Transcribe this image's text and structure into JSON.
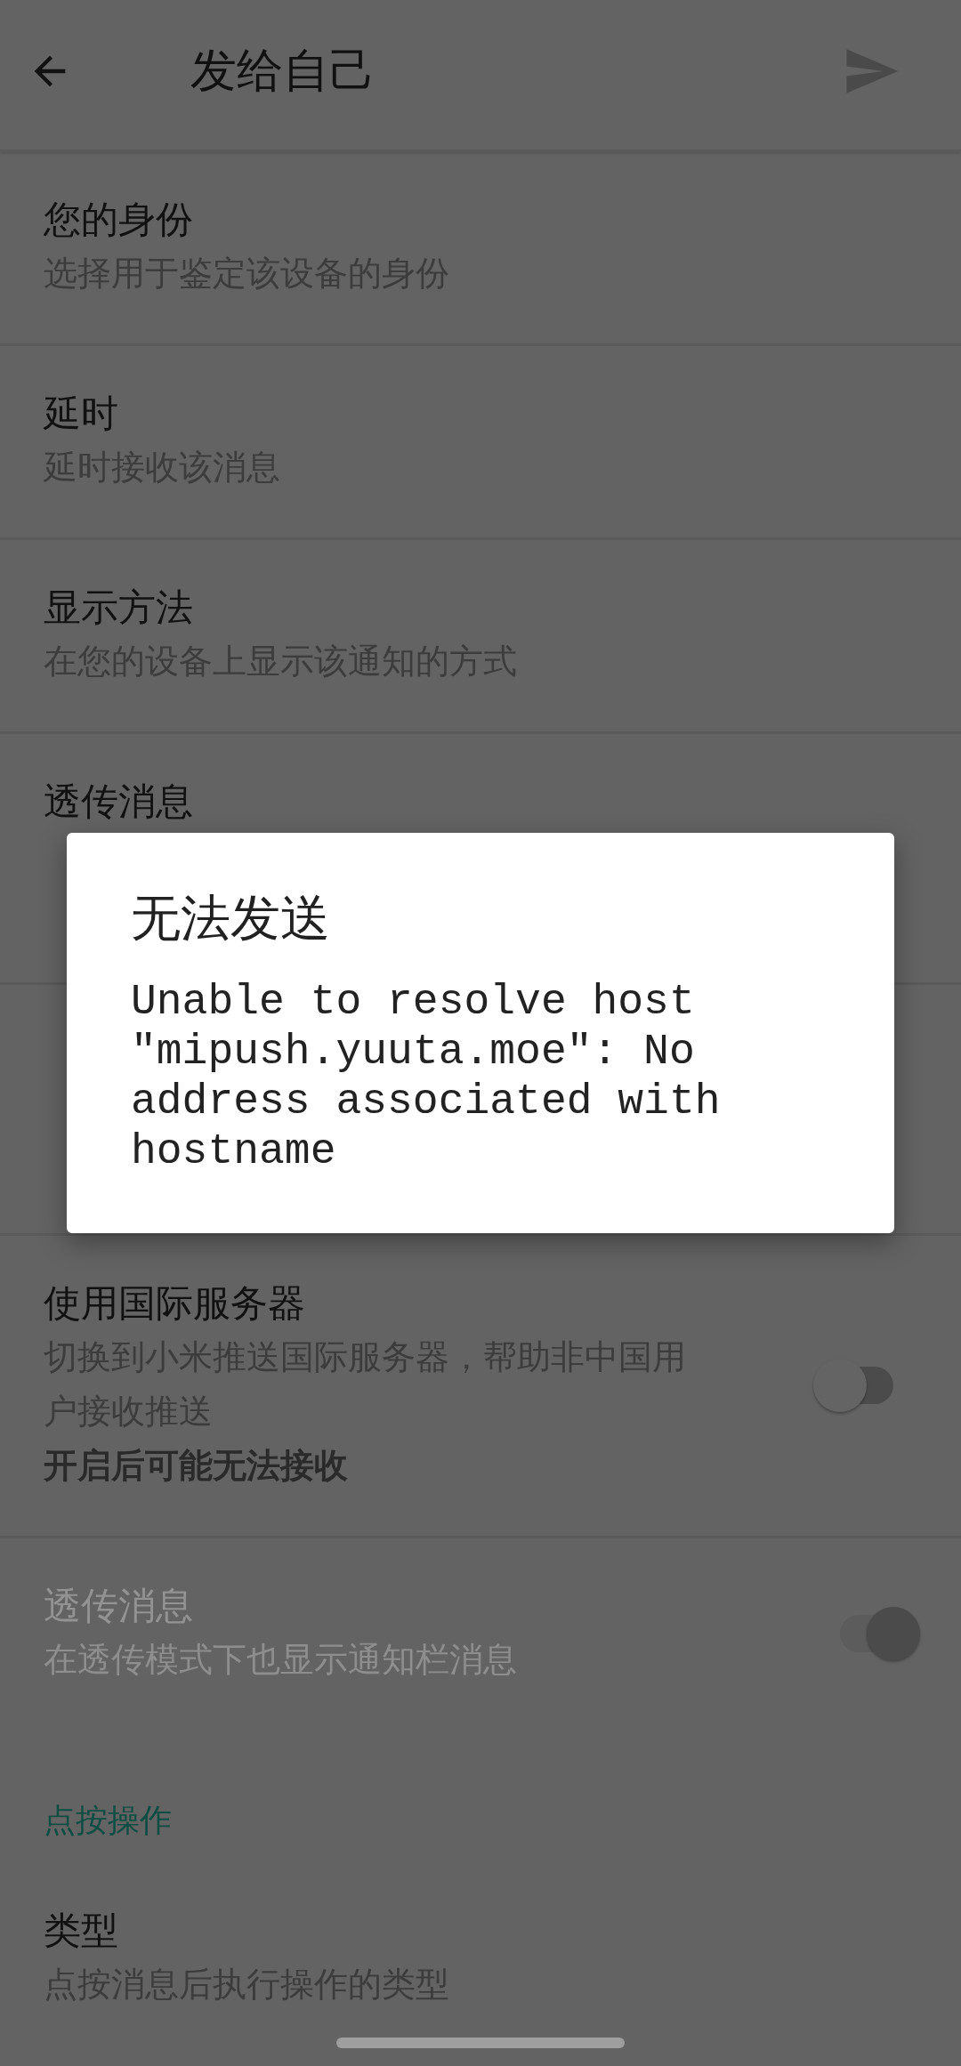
{
  "app_bar": {
    "title": "发给自己"
  },
  "rows": [
    {
      "kind": "text",
      "title": "您的身份",
      "subtitle": "选择用于鉴定该设备的身份"
    },
    {
      "kind": "text",
      "title": "延时",
      "subtitle": "延时接收该消息"
    },
    {
      "kind": "text",
      "title": "显示方法",
      "subtitle": "在您的设备上显示该通知的方式"
    },
    {
      "kind": "covered",
      "title": "透传消息"
    },
    {
      "kind": "covered"
    },
    {
      "kind": "switch",
      "title": "使用国际服务器",
      "subtitle": "切换到小米推送国际服务器，帮助非中国用户接收推送",
      "note": "开启后可能无法接收",
      "on": false,
      "disabled": false
    },
    {
      "kind": "switch",
      "title": "透传消息",
      "subtitle": "在透传模式下也显示通知栏消息",
      "on": true,
      "disabled": true
    }
  ],
  "section": {
    "header": "点按操作",
    "rows": [
      {
        "kind": "text",
        "title": "类型",
        "subtitle": "点按消息后执行操作的类型"
      }
    ]
  },
  "dialog": {
    "title": "无法发送",
    "message": "Unable to resolve host \"mipush.yuuta.moe\": No address associated with hostname"
  }
}
